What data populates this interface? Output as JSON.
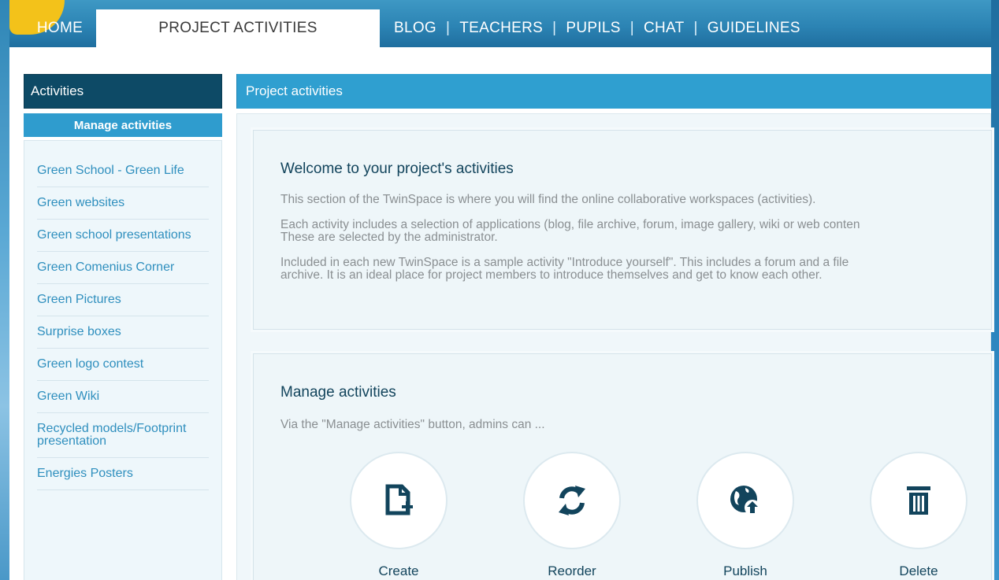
{
  "nav": {
    "home": "HOME",
    "active": "PROJECT ACTIVITIES",
    "links": [
      "BLOG",
      "TEACHERS",
      "PUPILS",
      "CHAT",
      "GUIDELINES"
    ],
    "separator": "|"
  },
  "sidebar": {
    "title": "Activities",
    "manage_button": "Manage activities",
    "items": [
      "Green School - Green Life",
      "Green websites",
      "Green school presentations",
      "Green Comenius Corner",
      "Green Pictures",
      "Surprise boxes",
      "Green logo contest",
      "Green Wiki",
      "Recycled models/Footprint presentation",
      "Energies Posters"
    ]
  },
  "main": {
    "title": "Project activities",
    "welcome": {
      "heading": "Welcome to your project's activities",
      "p1": "This section of the TwinSpace is where you will find the online collaborative workspaces (activities).",
      "p2a": "Each activity includes a selection of applications (blog, file archive, forum, image gallery, wiki or web conten",
      "p2b": "These are selected by the administrator.",
      "p3a": "Included in each new TwinSpace is a sample activity \"Introduce yourself\". This includes a forum and a file",
      "p3b": "archive. It is an ideal place for project members to introduce themselves and get to know each other."
    },
    "manage": {
      "heading": "Manage activities",
      "intro": "Via the \"Manage activities\" button, admins can ...",
      "actions": [
        {
          "label": "Create",
          "icon": "create-icon"
        },
        {
          "label": "Reorder",
          "icon": "reorder-icon"
        },
        {
          "label": "Publish",
          "icon": "publish-globe-icon"
        },
        {
          "label": "Delete",
          "icon": "trash-icon"
        }
      ]
    }
  },
  "colors": {
    "dark_header": "#0d4a66",
    "accent_blue": "#2f9fd0",
    "link_blue": "#2f8fbe",
    "icon_dark": "#12445c"
  }
}
